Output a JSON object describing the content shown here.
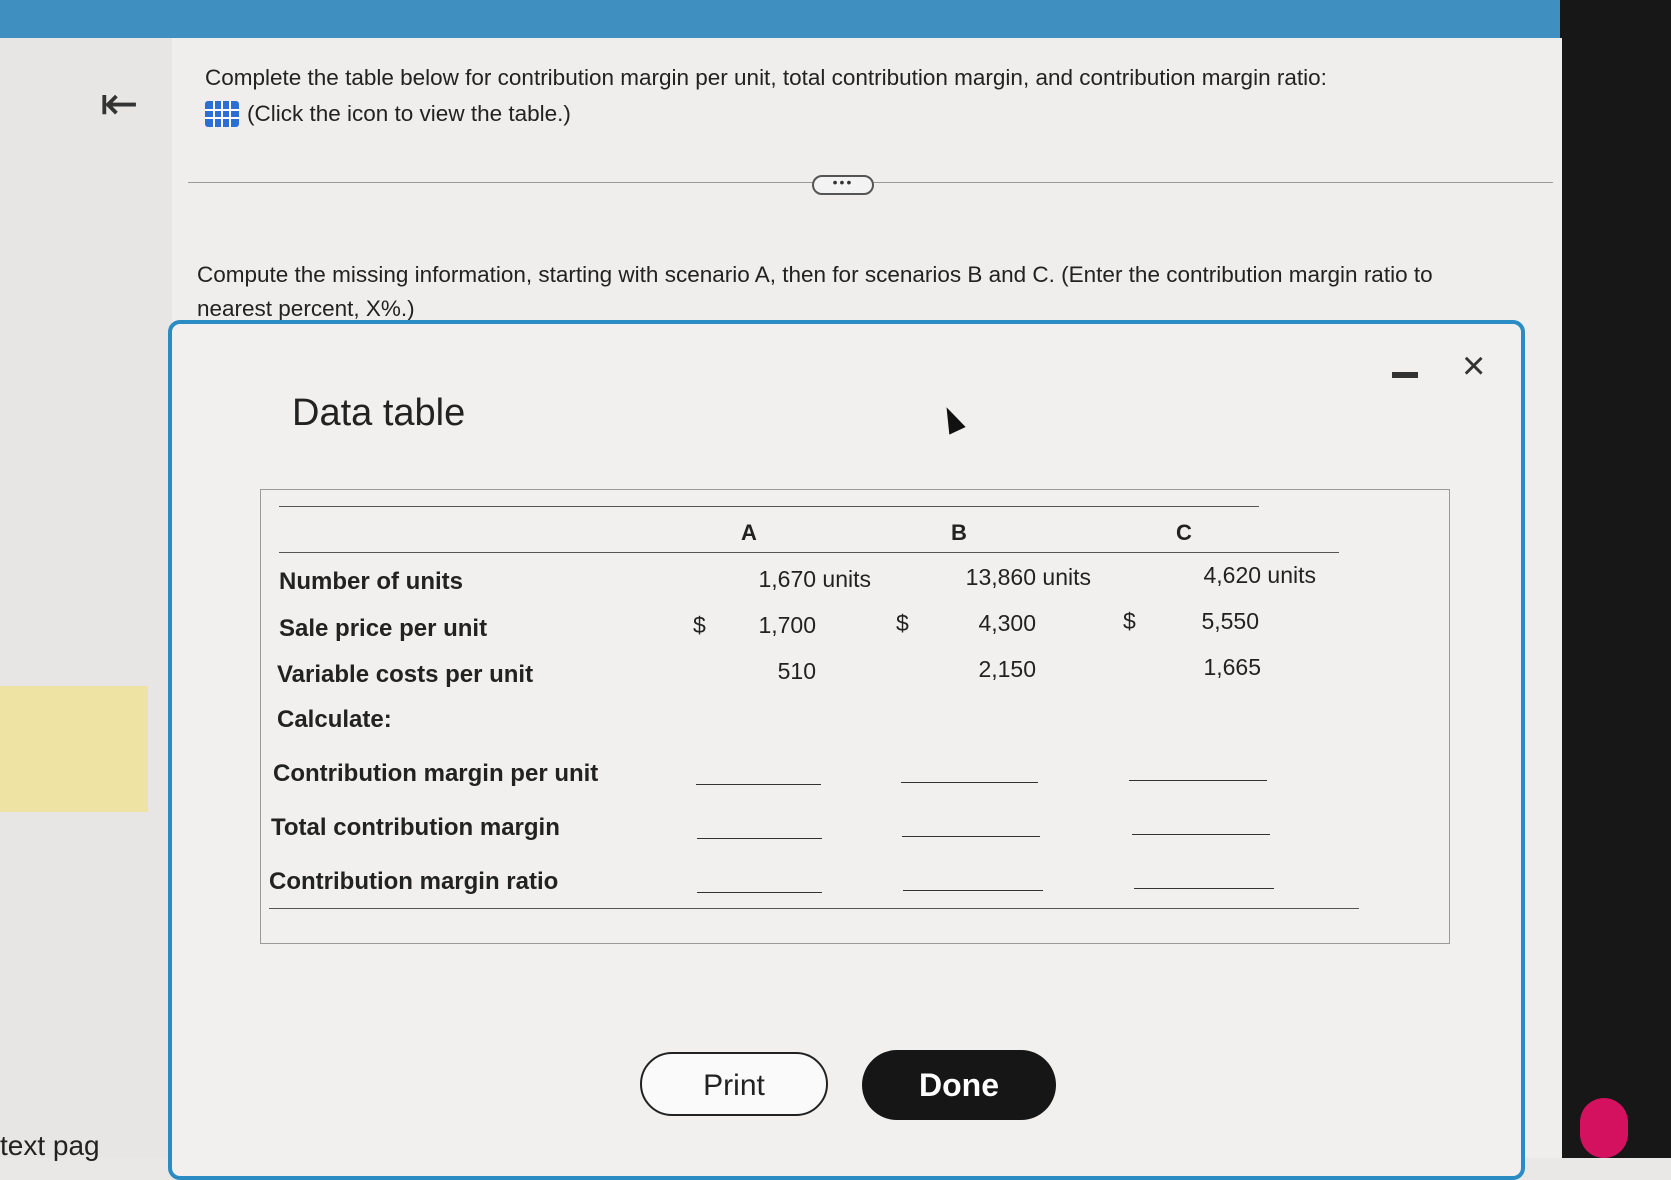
{
  "instructions": {
    "line1": "Complete the table below for contribution margin per unit, total contribution margin, and contribution margin ratio:",
    "link": "(Click the icon to view the table.)",
    "line2": "Compute the missing information, starting with scenario A, then for scenarios B and C. (Enter the contribution margin ratio to nearest percent, X%.)"
  },
  "divider": {
    "dots": "•••"
  },
  "modal": {
    "title": "Data table",
    "close": "×",
    "table": {
      "columns": [
        "A",
        "B",
        "C"
      ],
      "rows": [
        {
          "label": "Number of units",
          "values": [
            "1,670 units",
            "13,860 units",
            "4,620 units"
          ]
        },
        {
          "label": "Sale price per unit",
          "currency": "$",
          "values": [
            "1,700",
            "4,300",
            "5,550"
          ]
        },
        {
          "label": "Variable costs per unit",
          "values": [
            "510",
            "2,150",
            "1,665"
          ]
        }
      ],
      "calc_label": "Calculate:",
      "calc_rows": [
        "Contribution margin per unit",
        "Total contribution margin",
        "Contribution margin ratio"
      ]
    },
    "buttons": {
      "print": "Print",
      "done": "Done"
    }
  },
  "sidebar": {
    "text": "text pag"
  },
  "colors": {
    "accent": "#2a8cc2",
    "topbar": "#3f8fc1",
    "done_button": "#161616"
  }
}
